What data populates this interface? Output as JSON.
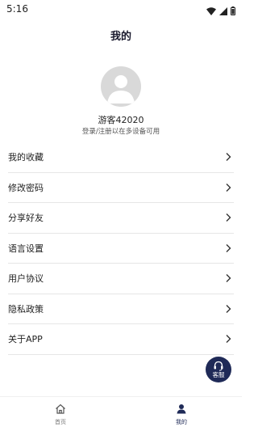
{
  "status_bar": {
    "time": "5:16",
    "icons": [
      "wifi-icon",
      "signal-icon",
      "battery-icon"
    ]
  },
  "header": {
    "title": "我的"
  },
  "profile": {
    "avatar_icon": "person-silhouette-icon",
    "username": "游客42020",
    "login_hint": "登录/注册以在多设备可用"
  },
  "menu": {
    "items": [
      {
        "label": "我的收藏",
        "icon": "chevron-right-icon"
      },
      {
        "label": "修改密码",
        "icon": "chevron-right-icon"
      },
      {
        "label": "分享好友",
        "icon": "chevron-right-icon"
      },
      {
        "label": "语言设置",
        "icon": "chevron-right-icon"
      },
      {
        "label": "用户协议",
        "icon": "chevron-right-icon"
      },
      {
        "label": "隐私政策",
        "icon": "chevron-right-icon"
      },
      {
        "label": "关于APP",
        "icon": "chevron-right-icon"
      }
    ]
  },
  "customer_service": {
    "label": "客服",
    "icon": "headset-icon"
  },
  "bottom_nav": {
    "home_label": "首页",
    "mine_label": "我的",
    "active": "mine"
  },
  "colors": {
    "accent": "#1f2a57",
    "text": "#222222",
    "divider": "#e6e6e6"
  }
}
